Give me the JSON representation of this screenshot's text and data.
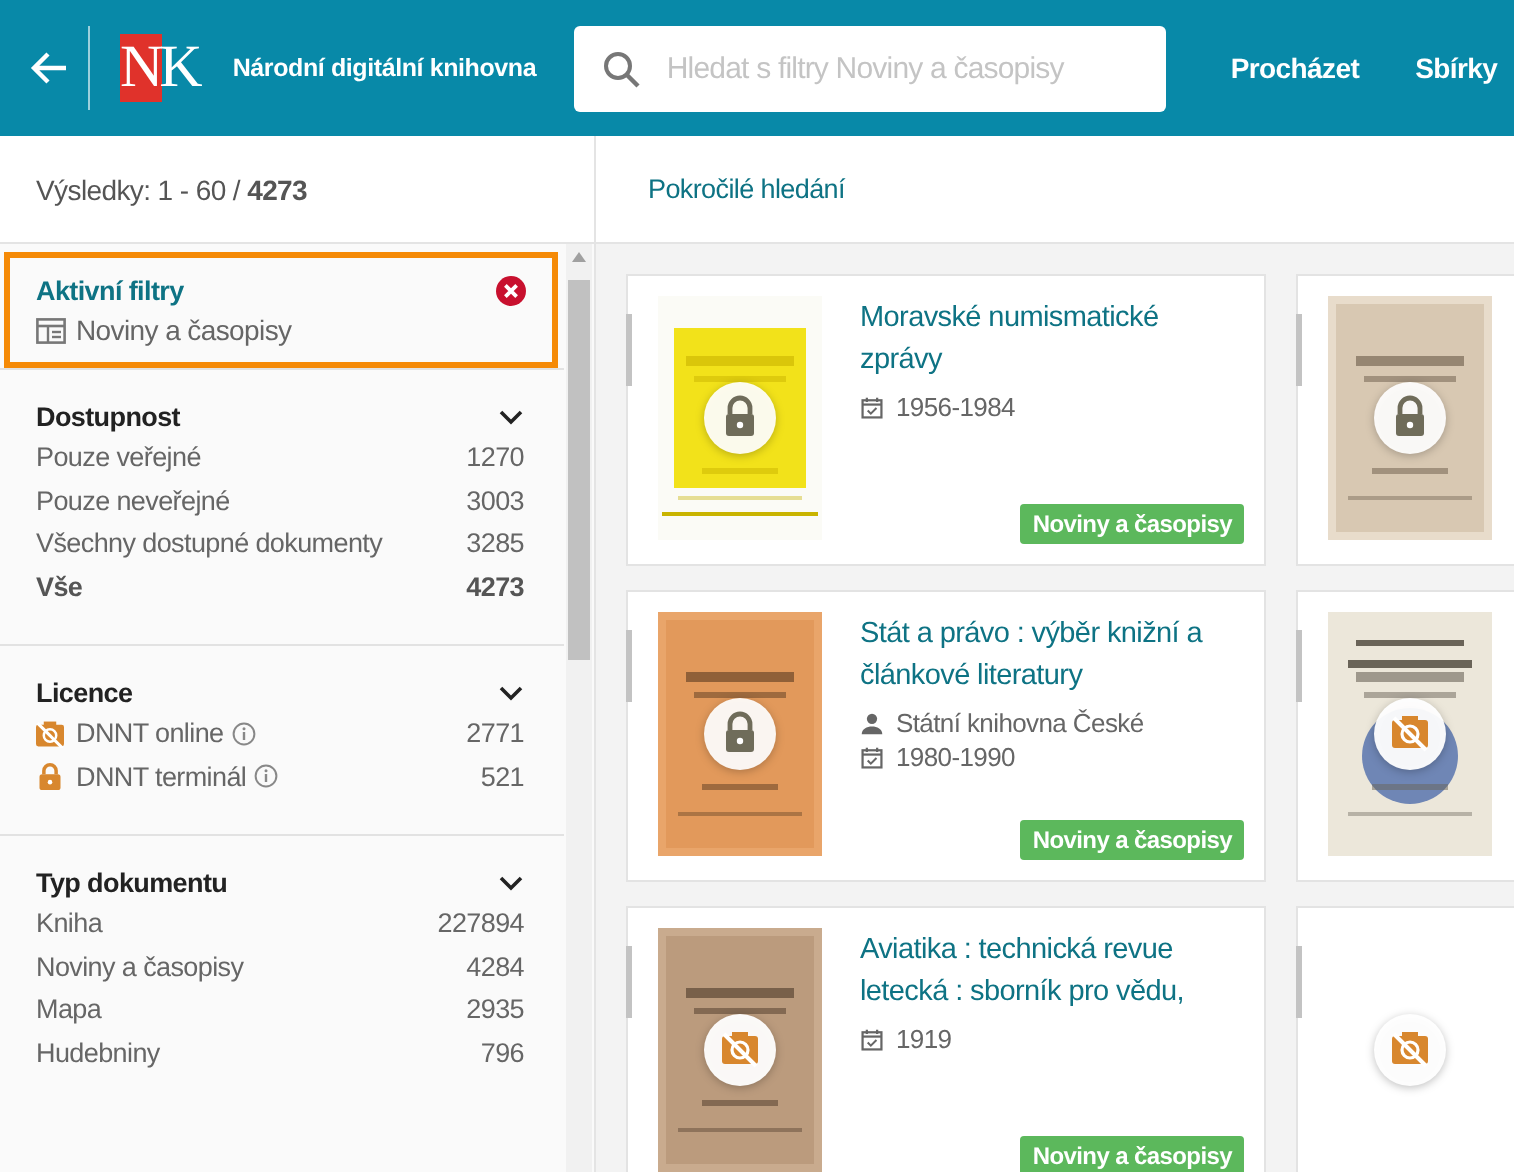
{
  "header": {
    "logo": "NK",
    "title": "Národní digitální knihovna",
    "search": {
      "placeholder": "Hledat s filtry Noviny a časopisy"
    },
    "nav": [
      "Procházet",
      "Sbírky"
    ]
  },
  "results": {
    "summary": "Výsledky: 1 - 60 / **4273**"
  },
  "advanced_search": "Pokročilé hledání",
  "active_filters": {
    "title": "Aktivní filtry",
    "items": [
      {
        "label": "Noviny a časopisy"
      }
    ]
  },
  "facets": [
    {
      "title": "Dostupnost",
      "expanded": true,
      "items": [
        {
          "label": "Pouze veřejné",
          "count": "1270",
          "selected": false
        },
        {
          "label": "Pouze neveřejné",
          "count": "3003",
          "selected": false
        },
        {
          "label": "Všechny dostupné dokumenty",
          "count": "3285",
          "selected": false
        },
        {
          "label": "Vše",
          "count": "4273",
          "selected": true
        }
      ]
    },
    {
      "title": "Licence",
      "expanded": true,
      "items": [
        {
          "label": "DNNT online",
          "count": "2771",
          "selected": false,
          "kind": "restricted",
          "info": true
        },
        {
          "label": "DNNT terminál",
          "count": "521",
          "selected": false,
          "kind": "lock",
          "info": true
        }
      ]
    },
    {
      "title": "Typ dokumentu",
      "expanded": true,
      "items": [
        {
          "label": "Kniha",
          "count": "227894",
          "selected": false
        },
        {
          "label": "Noviny a časopisy",
          "count": "4284",
          "selected": false
        },
        {
          "label": "Mapa",
          "count": "2935",
          "selected": false
        },
        {
          "label": "Hudebniny",
          "count": "796",
          "selected": false
        }
      ]
    }
  ],
  "cards": [
    {
      "title": "Moravské numismatické zprávy",
      "date": "1956-1984",
      "badge": "Noviny a časopisy",
      "kind": "lock"
    },
    {
      "kind": "lock"
    },
    {
      "title": "Stát a právo : výběr knižní a článkové literatury",
      "author": "Státní knihovna České",
      "date": "1980-1990",
      "badge": "Noviny a časopisy",
      "kind": "lock"
    },
    {
      "kind": "restricted"
    },
    {
      "title": "Aviatika : technická revue letecká : sborník pro vědu,",
      "date": "1919",
      "badge": "Noviny a časopisy",
      "kind": "restricted"
    },
    {
      "kind": "restricted"
    }
  ]
}
